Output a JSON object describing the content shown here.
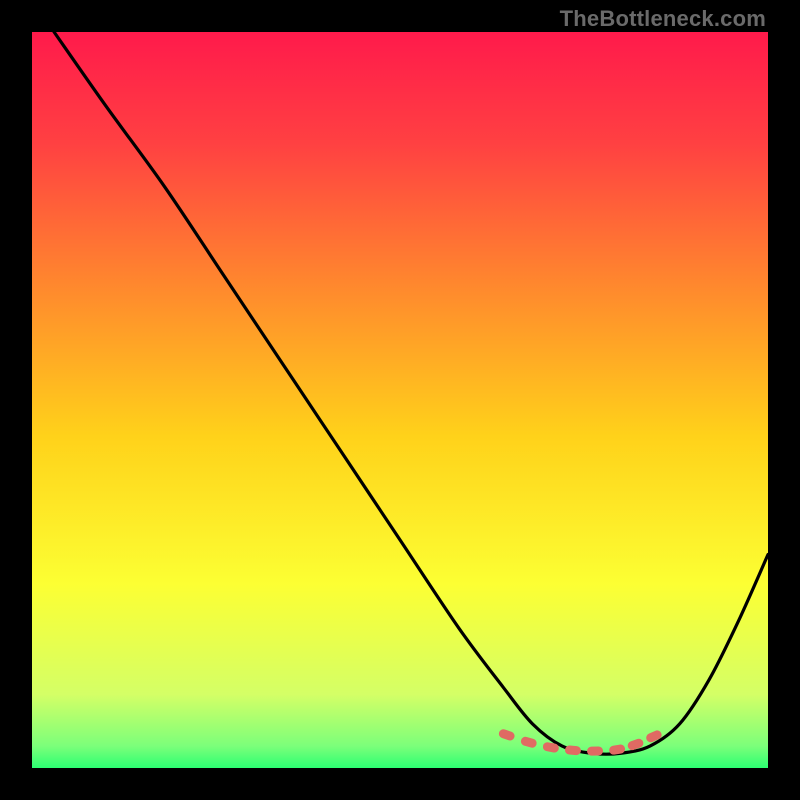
{
  "watermark": "TheBottleneck.com",
  "chart_data": {
    "type": "line",
    "title": "",
    "xlabel": "",
    "ylabel": "",
    "xlim": [
      0,
      100
    ],
    "ylim": [
      0,
      100
    ],
    "grid": false,
    "background_gradient": {
      "stops": [
        {
          "offset": 0.0,
          "color": "#ff1a4b"
        },
        {
          "offset": 0.15,
          "color": "#ff4042"
        },
        {
          "offset": 0.35,
          "color": "#ff8a2d"
        },
        {
          "offset": 0.55,
          "color": "#ffd21a"
        },
        {
          "offset": 0.75,
          "color": "#fcff33"
        },
        {
          "offset": 0.9,
          "color": "#d4ff66"
        },
        {
          "offset": 0.97,
          "color": "#7cff7a"
        },
        {
          "offset": 1.0,
          "color": "#2cff72"
        }
      ]
    },
    "series": [
      {
        "name": "curve",
        "color": "#000000",
        "x": [
          3,
          10,
          18,
          26,
          34,
          42,
          50,
          58,
          64,
          68,
          72,
          76,
          80,
          84,
          88,
          92,
          96,
          100
        ],
        "y": [
          100,
          90,
          79,
          67,
          55,
          43,
          31,
          19,
          11,
          6,
          3,
          2,
          2,
          3,
          6,
          12,
          20,
          29
        ]
      }
    ],
    "markers": {
      "name": "optimal-zone",
      "color": "#e06a63",
      "shape": "rounded-dash",
      "points": [
        {
          "x": 64.5,
          "y": 4.5
        },
        {
          "x": 67.5,
          "y": 3.5
        },
        {
          "x": 70.5,
          "y": 2.8
        },
        {
          "x": 73.5,
          "y": 2.4
        },
        {
          "x": 76.5,
          "y": 2.3
        },
        {
          "x": 79.5,
          "y": 2.5
        },
        {
          "x": 82.0,
          "y": 3.2
        },
        {
          "x": 84.5,
          "y": 4.3
        }
      ]
    }
  }
}
